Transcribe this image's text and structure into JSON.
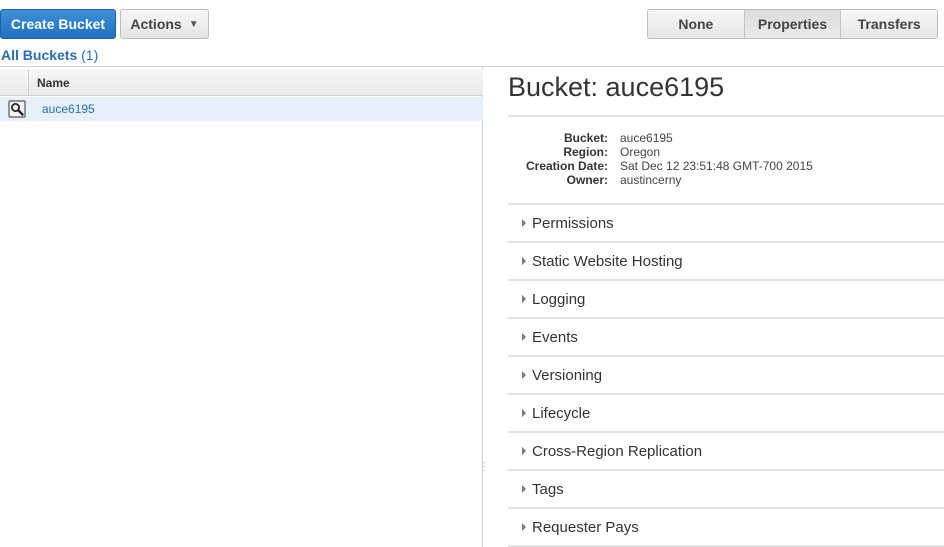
{
  "toolbar": {
    "create_bucket": "Create Bucket",
    "actions": "Actions",
    "chevron_icon": "chevron-down",
    "view_modes": [
      {
        "label": "None",
        "active": false
      },
      {
        "label": "Properties",
        "active": true
      },
      {
        "label": "Transfers",
        "active": false
      }
    ]
  },
  "bucket_list": {
    "heading": "All Buckets",
    "count": "(1)",
    "column_name": "Name",
    "rows": [
      {
        "name": "auce6195",
        "icon": "magnifier-icon",
        "selected": true
      }
    ]
  },
  "properties": {
    "title": "Bucket: auce6195",
    "info": [
      {
        "key": "Bucket:",
        "value": "auce6195"
      },
      {
        "key": "Region:",
        "value": "Oregon"
      },
      {
        "key": "Creation Date:",
        "value": "Sat Dec 12 23:51:48 GMT-700 2015"
      },
      {
        "key": "Owner:",
        "value": "austincerny"
      }
    ],
    "sections": [
      "Permissions",
      "Static Website Hosting",
      "Logging",
      "Events",
      "Versioning",
      "Lifecycle",
      "Cross-Region Replication",
      "Tags",
      "Requester Pays"
    ]
  },
  "colors": {
    "primary_button": "#2173c2",
    "link": "#2a6ebb",
    "selected_row": "#e5f0fb"
  }
}
